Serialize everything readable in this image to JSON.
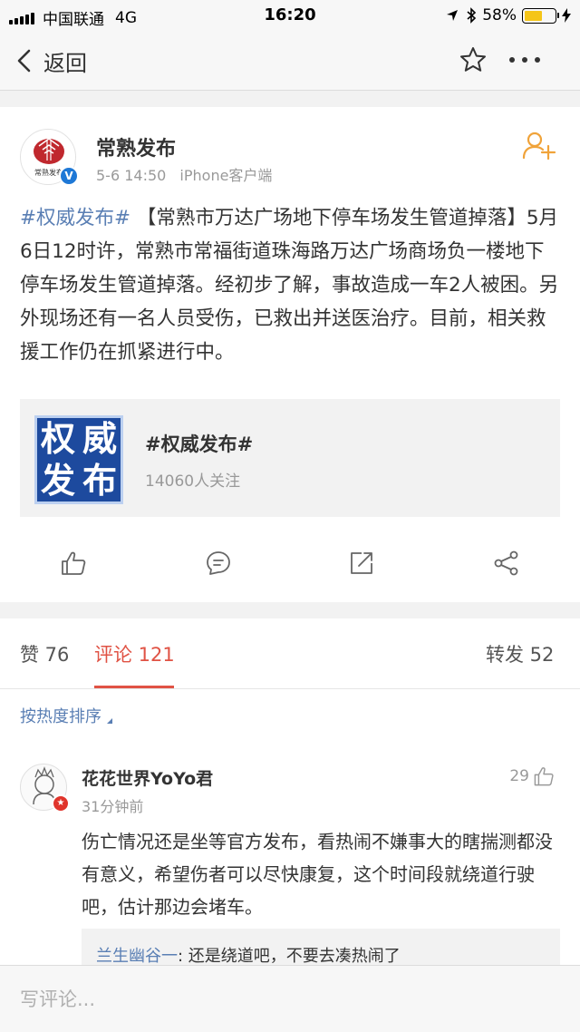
{
  "status_bar": {
    "carrier": "中国联通",
    "network": "4G",
    "time": "16:20",
    "battery": "58%",
    "battery_level": 0.58,
    "battery_color": "#f5c518"
  },
  "nav": {
    "back_label": "返回",
    "icons": [
      "chevron-left-icon",
      "star-icon",
      "more-icon"
    ]
  },
  "post": {
    "author": "常熟发布",
    "verified": true,
    "date": "5-6 14:50",
    "source": "iPhone客户端",
    "hashtag": "#权威发布#",
    "body": " 【常熟市万达广场地下停车场发生管道掉落】5月6日12时许，常熟市常福街道珠海路万达广场商场负一楼地下停车场发生管道掉落。经初步了解，事故造成一车2人被困。另外现场还有一名人员受伤，已救出并送医治疗。目前，相关救援工作仍在抓紧进行中。",
    "topic": {
      "image_text": [
        "权",
        "威",
        "发",
        "布"
      ],
      "title": "#权威发布#",
      "followers": "14060人关注"
    },
    "actions": [
      "like-icon",
      "comment-icon",
      "repost-icon",
      "share-icon"
    ]
  },
  "tabs": {
    "likes": "赞 76",
    "comments": "评论 121",
    "reposts": "转发 52"
  },
  "sort_label": "按热度排序",
  "comment": {
    "user": "花花世界YoYo君",
    "time": "31分钟前",
    "likes": "29",
    "text": "伤亡情况还是坐等官方发布，看热闹不嫌事大的瞎揣测都没有意义，希望伤者可以尽快康复，这个时间段就绕道行驶吧，估计那边会堵车。",
    "reply_user": "兰生幽谷一",
    "reply_text": ": 还是绕道吧，不要去凑热闹了"
  },
  "input": {
    "placeholder": "写评论..."
  },
  "colors": {
    "accent": "#e05244",
    "link": "#5a7fb4",
    "follow": "#f0a33a"
  }
}
